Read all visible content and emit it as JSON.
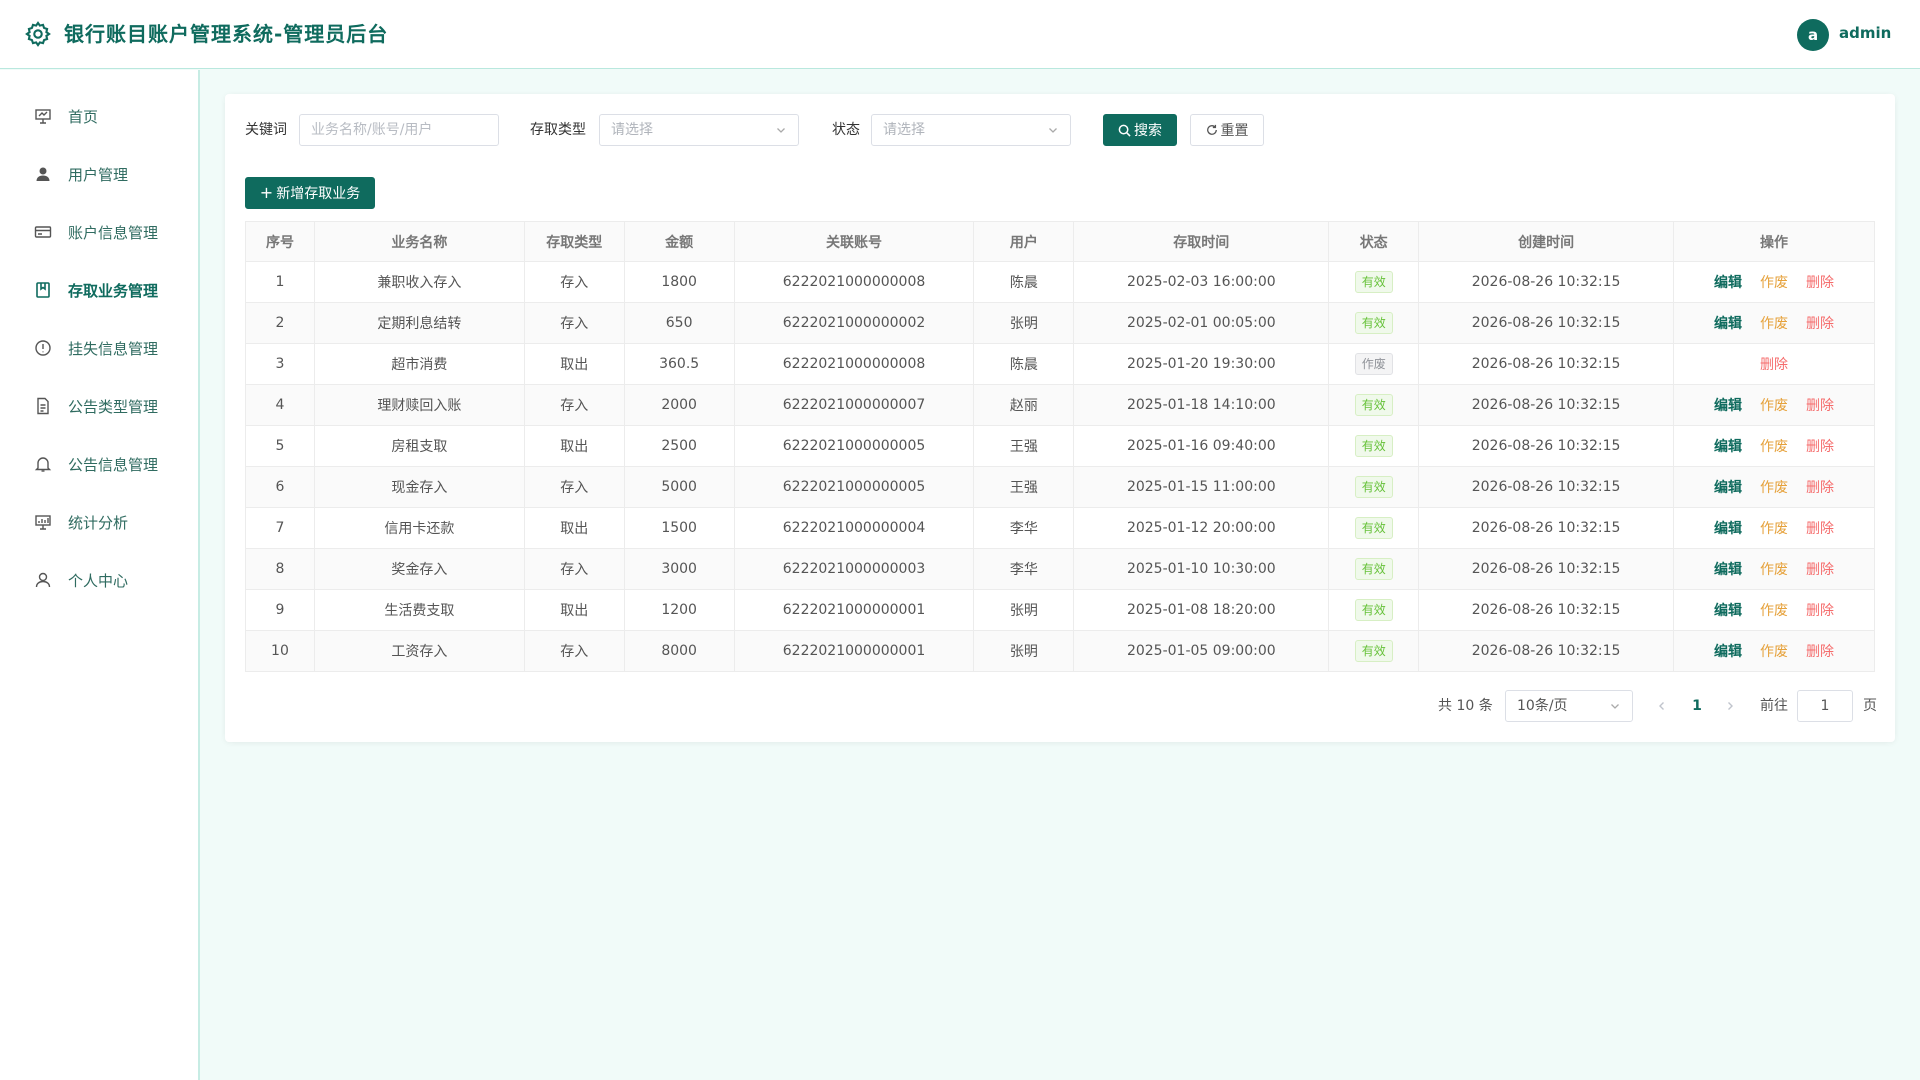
{
  "header": {
    "title": "银行账目账户管理系统-管理员后台",
    "avatar_letter": "a",
    "username": "admin"
  },
  "sidebar": {
    "items": [
      {
        "label": "首页",
        "icon": "dashboard-icon"
      },
      {
        "label": "用户管理",
        "icon": "user-icon"
      },
      {
        "label": "账户信息管理",
        "icon": "card-icon"
      },
      {
        "label": "存取业务管理",
        "icon": "notebook-icon",
        "active": true
      },
      {
        "label": "挂失信息管理",
        "icon": "info-icon"
      },
      {
        "label": "公告类型管理",
        "icon": "document-icon"
      },
      {
        "label": "公告信息管理",
        "icon": "bell-icon"
      },
      {
        "label": "统计分析",
        "icon": "chart-icon"
      },
      {
        "label": "个人中心",
        "icon": "profile-icon"
      }
    ]
  },
  "filters": {
    "keyword_label": "关键词",
    "keyword_placeholder": "业务名称/账号/用户",
    "type_label": "存取类型",
    "type_placeholder": "请选择",
    "status_label": "状态",
    "status_placeholder": "请选择",
    "search_button": "搜索",
    "reset_button": "重置"
  },
  "add_button": "新增存取业务",
  "table": {
    "columns": [
      "序号",
      "业务名称",
      "存取类型",
      "金额",
      "关联账号",
      "用户",
      "存取时间",
      "状态",
      "创建时间",
      "操作"
    ],
    "actions": {
      "edit": "编辑",
      "void": "作废",
      "delete": "删除"
    },
    "rows": [
      {
        "no": "1",
        "name": "兼职收入存入",
        "type": "存入",
        "amount": "1800",
        "account": "6222021000000008",
        "user": "陈晨",
        "time": "2025-02-03 16:00:00",
        "status": "有效",
        "created": "2026-08-26 10:32:15"
      },
      {
        "no": "2",
        "name": "定期利息结转",
        "type": "存入",
        "amount": "650",
        "account": "6222021000000002",
        "user": "张明",
        "time": "2025-02-01 00:05:00",
        "status": "有效",
        "created": "2026-08-26 10:32:15"
      },
      {
        "no": "3",
        "name": "超市消费",
        "type": "取出",
        "amount": "360.5",
        "account": "6222021000000008",
        "user": "陈晨",
        "time": "2025-01-20 19:30:00",
        "status": "作废",
        "created": "2026-08-26 10:32:15"
      },
      {
        "no": "4",
        "name": "理财赎回入账",
        "type": "存入",
        "amount": "2000",
        "account": "6222021000000007",
        "user": "赵丽",
        "time": "2025-01-18 14:10:00",
        "status": "有效",
        "created": "2026-08-26 10:32:15"
      },
      {
        "no": "5",
        "name": "房租支取",
        "type": "取出",
        "amount": "2500",
        "account": "6222021000000005",
        "user": "王强",
        "time": "2025-01-16 09:40:00",
        "status": "有效",
        "created": "2026-08-26 10:32:15"
      },
      {
        "no": "6",
        "name": "现金存入",
        "type": "存入",
        "amount": "5000",
        "account": "6222021000000005",
        "user": "王强",
        "time": "2025-01-15 11:00:00",
        "status": "有效",
        "created": "2026-08-26 10:32:15"
      },
      {
        "no": "7",
        "name": "信用卡还款",
        "type": "取出",
        "amount": "1500",
        "account": "6222021000000004",
        "user": "李华",
        "time": "2025-01-12 20:00:00",
        "status": "有效",
        "created": "2026-08-26 10:32:15"
      },
      {
        "no": "8",
        "name": "奖金存入",
        "type": "存入",
        "amount": "3000",
        "account": "6222021000000003",
        "user": "李华",
        "time": "2025-01-10 10:30:00",
        "status": "有效",
        "created": "2026-08-26 10:32:15"
      },
      {
        "no": "9",
        "name": "生活费支取",
        "type": "取出",
        "amount": "1200",
        "account": "6222021000000001",
        "user": "张明",
        "time": "2025-01-08 18:20:00",
        "status": "有效",
        "created": "2026-08-26 10:32:15"
      },
      {
        "no": "10",
        "name": "工资存入",
        "type": "存入",
        "amount": "8000",
        "account": "6222021000000001",
        "user": "张明",
        "time": "2025-01-05 09:00:00",
        "status": "有效",
        "created": "2026-08-26 10:32:15"
      }
    ]
  },
  "pagination": {
    "total_text": "共 10 条",
    "page_size": "10条/页",
    "current_page": "1",
    "goto_label": "前往",
    "goto_value": "1",
    "page_suffix": "页"
  },
  "colors": {
    "primary": "#0f6b5e",
    "valid_tag": "#67c23a",
    "void_action": "#e6a23c",
    "delete_action": "#f56c6c"
  }
}
